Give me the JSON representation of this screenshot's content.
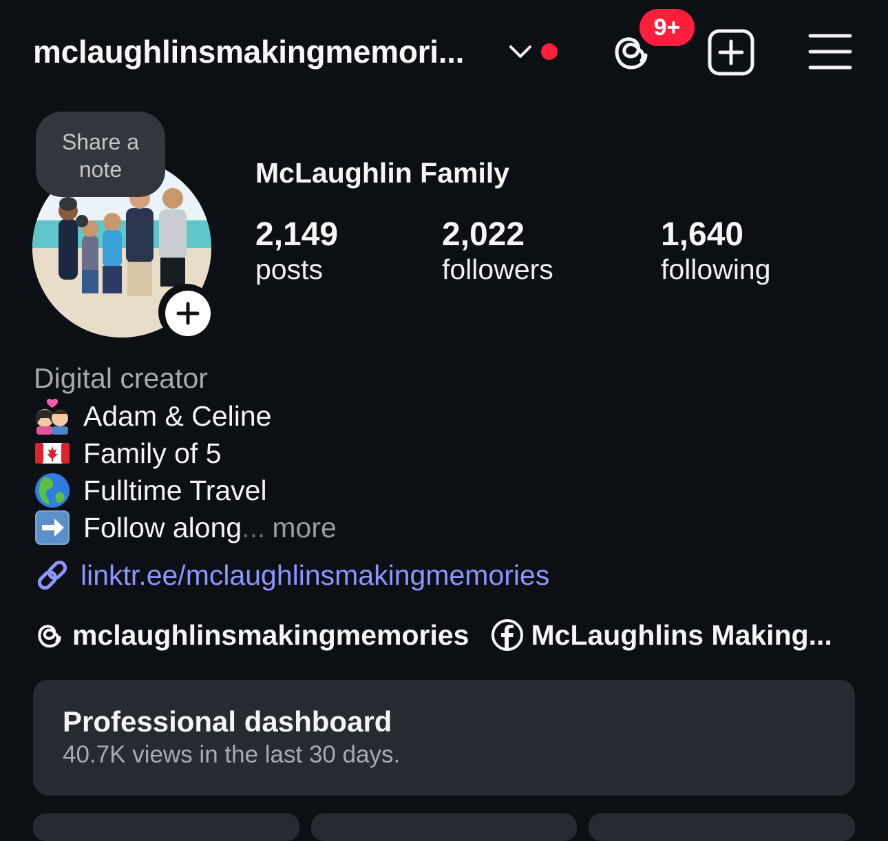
{
  "header": {
    "username": "mclaughlinsmakingmemori...",
    "notification_badge": "9+"
  },
  "profile": {
    "note_prompt_line1": "Share a",
    "note_prompt_line2": "note",
    "full_name": "McLaughlin Family",
    "stats": [
      {
        "value": "2,149",
        "label": "posts"
      },
      {
        "value": "2,022",
        "label": "followers"
      },
      {
        "value": "1,640",
        "label": "following"
      }
    ]
  },
  "bio": {
    "category": "Digital creator",
    "lines": [
      {
        "icon": "couple-heart-emoji",
        "text": "Adam & Celine"
      },
      {
        "icon": "canada-flag-emoji",
        "text": "Family of 5"
      },
      {
        "icon": "globe-americas-emoji",
        "text": "Fulltime Travel"
      },
      {
        "icon": "right-arrow-emoji",
        "text": "Follow along"
      }
    ],
    "ellipsis": "...",
    "more_label": "more",
    "link": "linktr.ee/mclaughlinsmakingmemories"
  },
  "social": {
    "threads_handle": "mclaughlinsmakingmemories",
    "facebook_name": "McLaughlins Making..."
  },
  "dashboard": {
    "title": "Professional dashboard",
    "subtitle": "40.7K views in the last 30 days."
  },
  "colors": {
    "background": "#0c0f14",
    "accent_red": "#ff1f3d",
    "link": "#8e95ff",
    "card": "#262a31"
  }
}
